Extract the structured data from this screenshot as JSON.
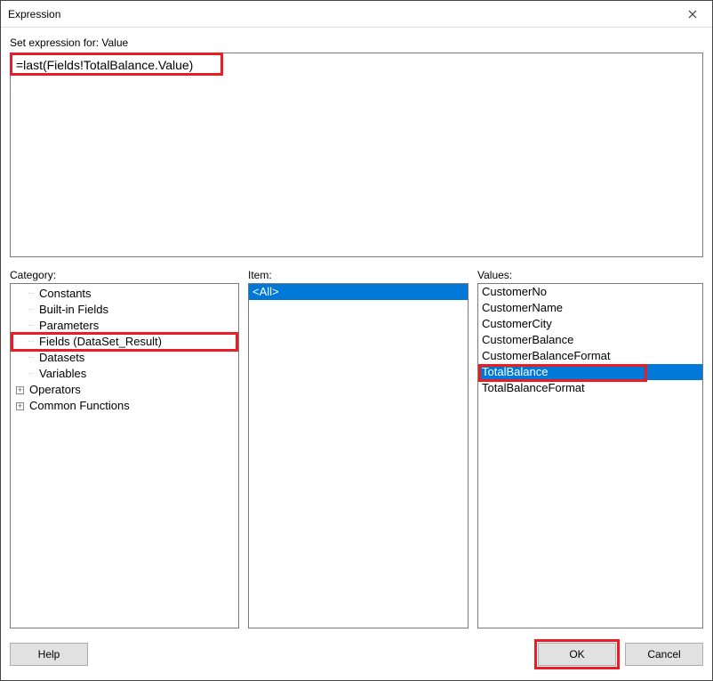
{
  "window": {
    "title": "Expression"
  },
  "setExpression": {
    "label": "Set expression for: Value"
  },
  "expression": {
    "value": "=last(Fields!TotalBalance.Value)"
  },
  "categoryLabel": "Category:",
  "itemLabel": "Item:",
  "valuesLabel": "Values:",
  "categoryTree": {
    "items": [
      {
        "label": "Constants",
        "expandable": false
      },
      {
        "label": "Built-in Fields",
        "expandable": false
      },
      {
        "label": "Parameters",
        "expandable": false
      },
      {
        "label": "Fields (DataSet_Result)",
        "expandable": false,
        "highlighted": true
      },
      {
        "label": "Datasets",
        "expandable": false
      },
      {
        "label": "Variables",
        "expandable": false
      },
      {
        "label": "Operators",
        "expandable": true
      },
      {
        "label": "Common Functions",
        "expandable": true
      }
    ]
  },
  "itemList": {
    "items": [
      {
        "label": "<All>",
        "selected": true
      }
    ]
  },
  "valuesList": {
    "items": [
      {
        "label": "CustomerNo"
      },
      {
        "label": "CustomerName"
      },
      {
        "label": "CustomerCity"
      },
      {
        "label": "CustomerBalance"
      },
      {
        "label": "CustomerBalanceFormat"
      },
      {
        "label": "TotalBalance",
        "selected": true,
        "highlighted": true
      },
      {
        "label": "TotalBalanceFormat"
      }
    ]
  },
  "buttons": {
    "help": "Help",
    "ok": "OK",
    "cancel": "Cancel"
  }
}
